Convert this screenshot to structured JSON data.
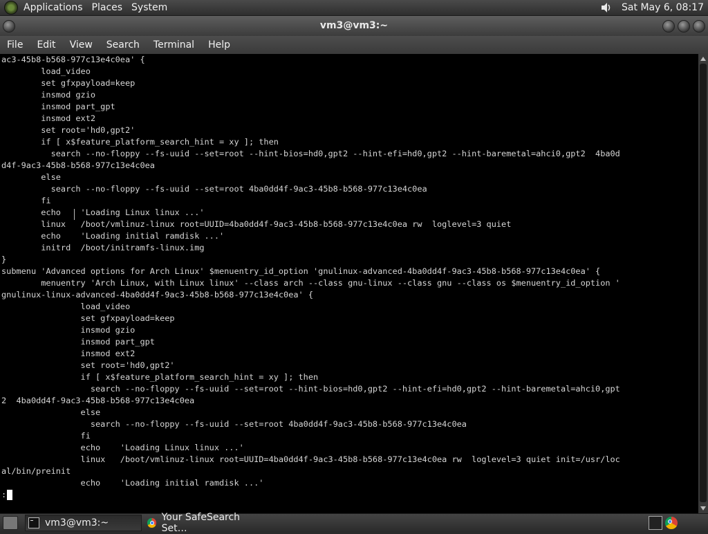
{
  "top_panel": {
    "menus": [
      "Applications",
      "Places",
      "System"
    ],
    "clock": "Sat May  6, 08:17"
  },
  "window": {
    "title": "vm3@vm3:~"
  },
  "menubar": [
    "File",
    "Edit",
    "View",
    "Search",
    "Terminal",
    "Help"
  ],
  "terminal": {
    "lines": [
      "ac3-45b8-b568-977c13e4c0ea' {",
      "        load_video",
      "        set gfxpayload=keep",
      "        insmod gzio",
      "        insmod part_gpt",
      "        insmod ext2",
      "        set root='hd0,gpt2'",
      "        if [ x$feature_platform_search_hint = xy ]; then",
      "          search --no-floppy --fs-uuid --set=root --hint-bios=hd0,gpt2 --hint-efi=hd0,gpt2 --hint-baremetal=ahci0,gpt2  4ba0d",
      "d4f-9ac3-45b8-b568-977c13e4c0ea",
      "        else",
      "          search --no-floppy --fs-uuid --set=root 4ba0dd4f-9ac3-45b8-b568-977c13e4c0ea",
      "        fi",
      "        echo    'Loading Linux linux ...'",
      "        linux   /boot/vmlinuz-linux root=UUID=4ba0dd4f-9ac3-45b8-b568-977c13e4c0ea rw  loglevel=3 quiet",
      "        echo    'Loading initial ramdisk ...'",
      "        initrd  /boot/initramfs-linux.img",
      "}",
      "submenu 'Advanced options for Arch Linux' $menuentry_id_option 'gnulinux-advanced-4ba0dd4f-9ac3-45b8-b568-977c13e4c0ea' {",
      "        menuentry 'Arch Linux, with Linux linux' --class arch --class gnu-linux --class gnu --class os $menuentry_id_option '",
      "gnulinux-linux-advanced-4ba0dd4f-9ac3-45b8-b568-977c13e4c0ea' {",
      "                load_video",
      "                set gfxpayload=keep",
      "                insmod gzio",
      "                insmod part_gpt",
      "                insmod ext2",
      "                set root='hd0,gpt2'",
      "                if [ x$feature_platform_search_hint = xy ]; then",
      "                  search --no-floppy --fs-uuid --set=root --hint-bios=hd0,gpt2 --hint-efi=hd0,gpt2 --hint-baremetal=ahci0,gpt",
      "2  4ba0dd4f-9ac3-45b8-b568-977c13e4c0ea",
      "                else",
      "                  search --no-floppy --fs-uuid --set=root 4ba0dd4f-9ac3-45b8-b568-977c13e4c0ea",
      "                fi",
      "                echo    'Loading Linux linux ...'",
      "                linux   /boot/vmlinuz-linux root=UUID=4ba0dd4f-9ac3-45b8-b568-977c13e4c0ea rw  loglevel=3 quiet init=/usr/loc",
      "al/bin/preinit",
      "                echo    'Loading initial ramdisk ...'"
    ],
    "prompt": ":"
  },
  "taskbar": {
    "tasks": [
      {
        "label": "vm3@vm3:~",
        "icon": "terminal-icon"
      },
      {
        "label": "Your SafeSearch Set…",
        "icon": "chrome-icon"
      }
    ],
    "tray_icons": [
      "terminal-icon",
      "chrome-icon"
    ]
  },
  "colors": {
    "terminal_bg": "#000000",
    "terminal_fg": "#d6d6d6",
    "panel_bg": "#3a3a3a"
  }
}
